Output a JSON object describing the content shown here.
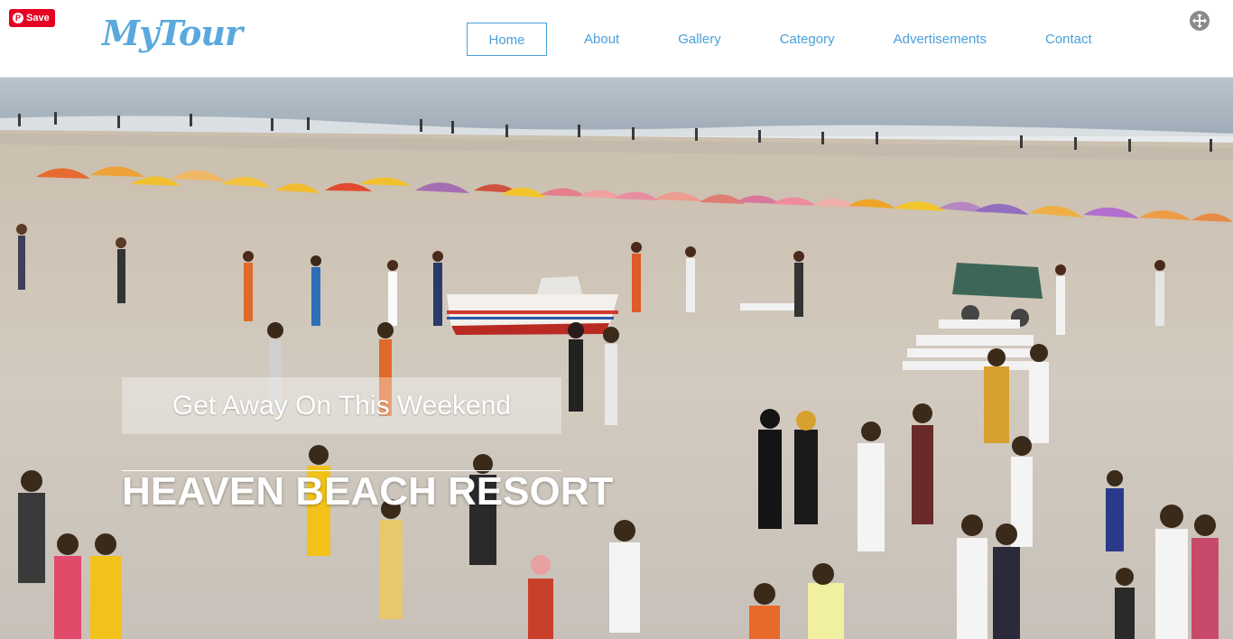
{
  "pinterest": {
    "save_label": "Save"
  },
  "brand": {
    "logo_text": "MyTour"
  },
  "nav": {
    "items": [
      {
        "label": "Home",
        "active": true
      },
      {
        "label": "About",
        "active": false
      },
      {
        "label": "Gallery",
        "active": false
      },
      {
        "label": "Category",
        "active": false
      },
      {
        "label": "Advertisements",
        "active": false
      },
      {
        "label": "Contact",
        "active": false
      }
    ]
  },
  "hero": {
    "tagline": "Get Away On This Weekend",
    "title": "HEAVEN BEACH RESORT",
    "image_icon": "beach-photo"
  },
  "colors": {
    "accent": "#4aa0d8",
    "logo": "#5aa9dd",
    "pinterest": "#e60023",
    "sand": "#cfc7bd",
    "sea": "#a9b7c2"
  },
  "icons": {
    "fullscreen": "expand-icon"
  }
}
